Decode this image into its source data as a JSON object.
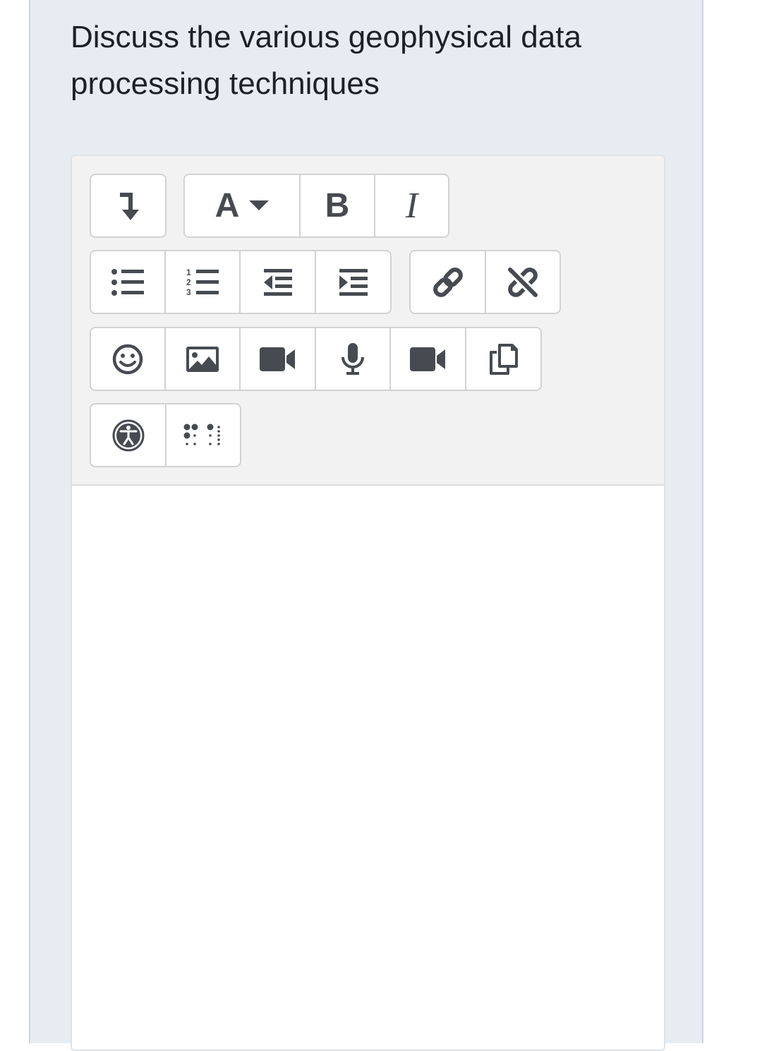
{
  "question": {
    "text": "Discuss the various geophysical data processing techniques"
  },
  "colors": {
    "panel_background": "#e7ecf3",
    "toolbar_background": "#f2f2f2",
    "icon_color": "#474b51",
    "text_color": "#1d2125"
  },
  "editor": {
    "content": "",
    "toolbar": {
      "rows": [
        {
          "groups": [
            [
              {
                "icon": "collapse-icon"
              }
            ],
            [
              {
                "icon": "font-style-icon",
                "label": "A"
              },
              {
                "icon": "bold-icon",
                "label": "B"
              },
              {
                "icon": "italic-icon",
                "label": "I"
              }
            ]
          ]
        },
        {
          "groups": [
            [
              {
                "icon": "unordered-list-icon"
              },
              {
                "icon": "ordered-list-icon"
              },
              {
                "icon": "outdent-icon"
              },
              {
                "icon": "indent-icon"
              }
            ],
            [
              {
                "icon": "link-icon"
              },
              {
                "icon": "unlink-icon"
              }
            ]
          ]
        },
        {
          "groups": [
            [
              {
                "icon": "emoji-icon"
              },
              {
                "icon": "image-icon"
              },
              {
                "icon": "video-icon"
              },
              {
                "icon": "microphone-icon"
              },
              {
                "icon": "video-record-icon"
              },
              {
                "icon": "copy-icon"
              }
            ]
          ]
        },
        {
          "groups": [
            [
              {
                "icon": "accessibility-icon"
              },
              {
                "icon": "braille-icon"
              }
            ]
          ]
        }
      ]
    }
  }
}
